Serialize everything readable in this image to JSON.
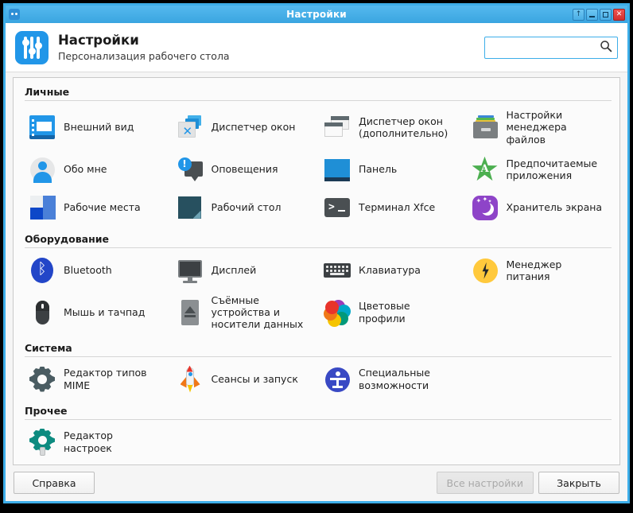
{
  "window": {
    "title": "Настройки",
    "controls": [
      {
        "name": "shade-button",
        "glyph": "↑"
      },
      {
        "name": "minimize-button",
        "glyph": "_"
      },
      {
        "name": "maximize-button",
        "glyph": "□"
      },
      {
        "name": "close-button",
        "glyph": "✕"
      }
    ]
  },
  "header": {
    "title": "Настройки",
    "subtitle": "Персонализация рабочего стола",
    "icon": "settings-sliders-icon",
    "search": {
      "value": "",
      "placeholder": "",
      "icon": "search-icon"
    }
  },
  "sections": [
    {
      "title": "Личные",
      "items": [
        {
          "label": "Внешний вид",
          "icon": "appearance-icon"
        },
        {
          "label": "Диспетчер окон",
          "icon": "window-manager-icon"
        },
        {
          "label": "Диспетчер окон (дополнительно)",
          "icon": "window-manager-tweaks-icon"
        },
        {
          "label": "Настройки менеджера файлов",
          "icon": "file-manager-settings-icon"
        },
        {
          "label": "Обо мне",
          "icon": "about-me-icon"
        },
        {
          "label": "Оповещения",
          "icon": "notifications-icon"
        },
        {
          "label": "Панель",
          "icon": "panel-icon"
        },
        {
          "label": "Предпочитаемые приложения",
          "icon": "preferred-applications-icon"
        },
        {
          "label": "Рабочие места",
          "icon": "workspaces-icon"
        },
        {
          "label": "Рабочий стол",
          "icon": "desktop-icon"
        },
        {
          "label": "Терминал Xfce",
          "icon": "terminal-icon"
        },
        {
          "label": "Хранитель экрана",
          "icon": "screensaver-icon"
        }
      ]
    },
    {
      "title": "Оборудование",
      "items": [
        {
          "label": "Bluetooth",
          "icon": "bluetooth-icon"
        },
        {
          "label": "Дисплей",
          "icon": "display-icon"
        },
        {
          "label": "Клавиатура",
          "icon": "keyboard-icon"
        },
        {
          "label": "Менеджер питания",
          "icon": "power-manager-icon"
        },
        {
          "label": "Мышь и тачпад",
          "icon": "mouse-touchpad-icon"
        },
        {
          "label": "Съёмные устройства и носители данных",
          "icon": "removable-media-icon"
        },
        {
          "label": "Цветовые профили",
          "icon": "color-profiles-icon"
        }
      ]
    },
    {
      "title": "Система",
      "items": [
        {
          "label": "Редактор типов MIME",
          "icon": "mime-type-editor-icon"
        },
        {
          "label": "Сеансы и запуск",
          "icon": "sessions-startup-icon"
        },
        {
          "label": "Специальные возможности",
          "icon": "accessibility-icon"
        }
      ]
    },
    {
      "title": "Прочее",
      "items": [
        {
          "label": "Редактор настроек",
          "icon": "settings-editor-icon"
        }
      ]
    }
  ],
  "footer": {
    "help_label": "Справка",
    "all_settings_label": "Все настройки",
    "all_settings_disabled": true,
    "close_label": "Закрыть"
  },
  "colors": {
    "titlebar": "#3daee9",
    "accent": "#2196e8",
    "close_button": "#d32f2f",
    "content_bg": "#fbfbfb"
  }
}
